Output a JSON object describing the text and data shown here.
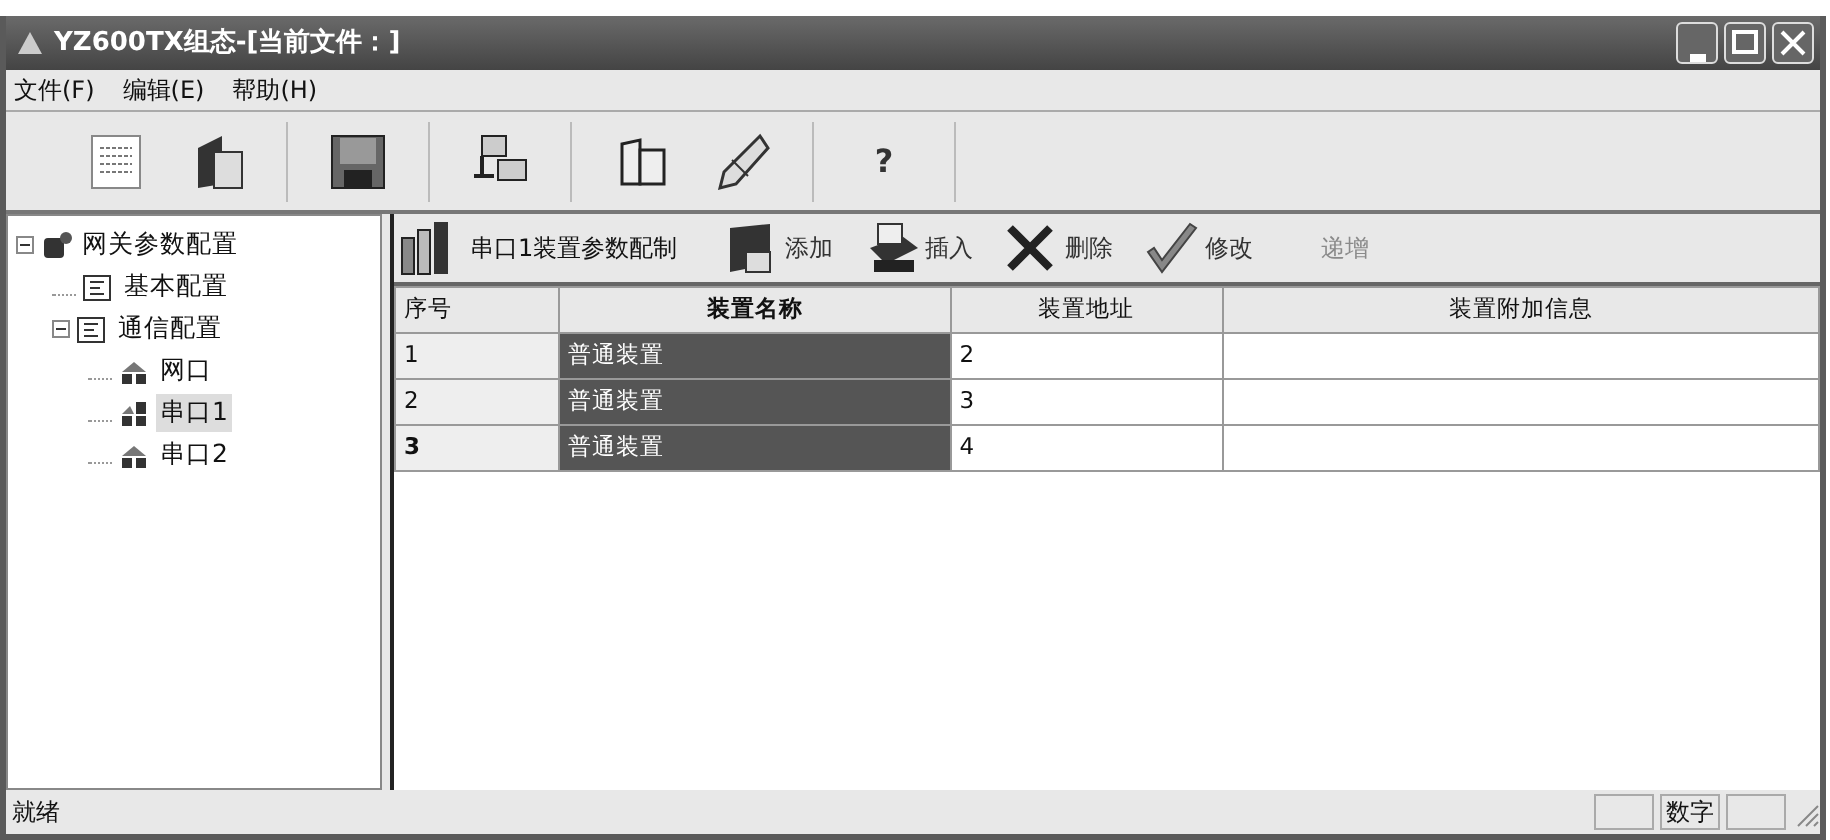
{
  "window": {
    "title": "YZ600TX组态-[当前文件：]"
  },
  "menu": [
    {
      "label": "文件(F)"
    },
    {
      "label": "编辑(E)"
    },
    {
      "label": "帮助(H)"
    }
  ],
  "toolbar": [
    {
      "kind": "list"
    },
    {
      "kind": "book"
    },
    {
      "kind": "sep"
    },
    {
      "kind": "save"
    },
    {
      "kind": "sep"
    },
    {
      "kind": "network"
    },
    {
      "kind": "sep"
    },
    {
      "kind": "open-book"
    },
    {
      "kind": "pen"
    },
    {
      "kind": "sep"
    },
    {
      "kind": "help",
      "label": "?"
    },
    {
      "kind": "sep"
    }
  ],
  "tree": [
    {
      "label": "网关参数配置",
      "kind": "gateway",
      "expanded": true,
      "selected": false,
      "children": [
        {
          "label": "基本配置",
          "kind": "form",
          "selected": false
        },
        {
          "label": "通信配置",
          "kind": "form",
          "expanded": true,
          "selected": false,
          "children": [
            {
              "label": "网口",
              "kind": "port",
              "selected": false
            },
            {
              "label": "串口1",
              "kind": "port-active",
              "selected": true
            },
            {
              "label": "串口2",
              "kind": "port",
              "selected": false
            }
          ]
        }
      ]
    }
  ],
  "panel": {
    "title": "串口1装置参数配制",
    "actions": [
      {
        "label": "添加",
        "kind": "notepad",
        "disabled": false
      },
      {
        "label": "插入",
        "kind": "printer",
        "disabled": false
      },
      {
        "label": "删除",
        "kind": "cross",
        "disabled": false
      },
      {
        "label": "修改",
        "kind": "check",
        "disabled": false
      },
      {
        "label": "递增",
        "kind": "text",
        "disabled": true
      }
    ],
    "table": {
      "columns": [
        {
          "label": "序号",
          "bold": false
        },
        {
          "label": "装置名称",
          "bold": true
        },
        {
          "label": "装置地址",
          "bold": false
        },
        {
          "label": "装置附加信息",
          "bold": false
        }
      ],
      "rows": [
        {
          "cells": [
            "1",
            "普通装置",
            "2",
            ""
          ],
          "current": false
        },
        {
          "cells": [
            "2",
            "普通装置",
            "3",
            ""
          ],
          "current": false
        },
        {
          "cells": [
            "3",
            "普通装置",
            "4",
            ""
          ],
          "current": true
        }
      ]
    }
  },
  "status_bar": {
    "text": "就绪",
    "indicators": [
      "数字"
    ]
  }
}
